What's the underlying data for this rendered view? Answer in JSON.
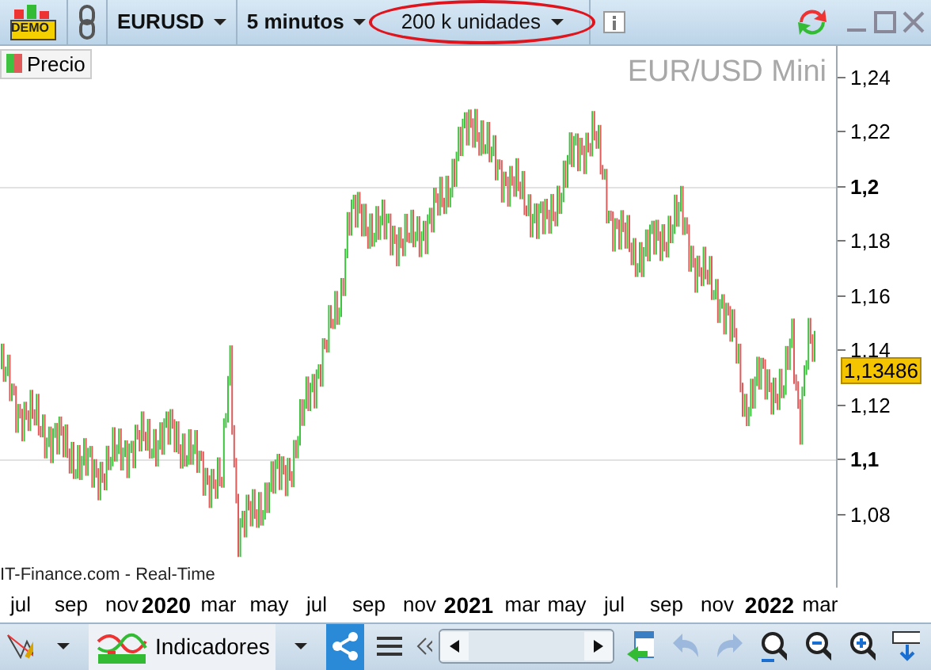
{
  "toolbar": {
    "badge": "DEMO",
    "symbol": "EURUSD",
    "interval": "5 minutos",
    "units": {
      "label": "200 k unidades",
      "highlighted": true
    }
  },
  "chart": {
    "title": "EUR/USD Mini",
    "legend": "Precio",
    "source": "IT-Finance.com - Real-Time",
    "current_price": "1,13486",
    "y_ticks": [
      {
        "label": "1,24",
        "major": false
      },
      {
        "label": "1,22",
        "major": false
      },
      {
        "label": "1,2",
        "major": true
      },
      {
        "label": "1,18",
        "major": false
      },
      {
        "label": "1,16",
        "major": false
      },
      {
        "label": "1,14",
        "major": false
      },
      {
        "label": "1,12",
        "major": false
      },
      {
        "label": "1,1",
        "major": true
      },
      {
        "label": "1,08",
        "major": false
      }
    ],
    "x_labels": [
      {
        "label": "jul",
        "major": false
      },
      {
        "label": "sep",
        "major": false
      },
      {
        "label": "nov",
        "major": false
      },
      {
        "label": "2020",
        "major": true
      },
      {
        "label": "mar",
        "major": false
      },
      {
        "label": "may",
        "major": false
      },
      {
        "label": "jul",
        "major": false
      },
      {
        "label": "sep",
        "major": false
      },
      {
        "label": "nov",
        "major": false
      },
      {
        "label": "2021",
        "major": true
      },
      {
        "label": "mar",
        "major": false
      },
      {
        "label": "may",
        "major": false
      },
      {
        "label": "jul",
        "major": false
      },
      {
        "label": "sep",
        "major": false
      },
      {
        "label": "nov",
        "major": false
      },
      {
        "label": "2022",
        "major": true
      },
      {
        "label": "mar",
        "major": false
      }
    ]
  },
  "bottom_toolbar": {
    "indicators": "Indicadores",
    "share_active": true
  }
}
